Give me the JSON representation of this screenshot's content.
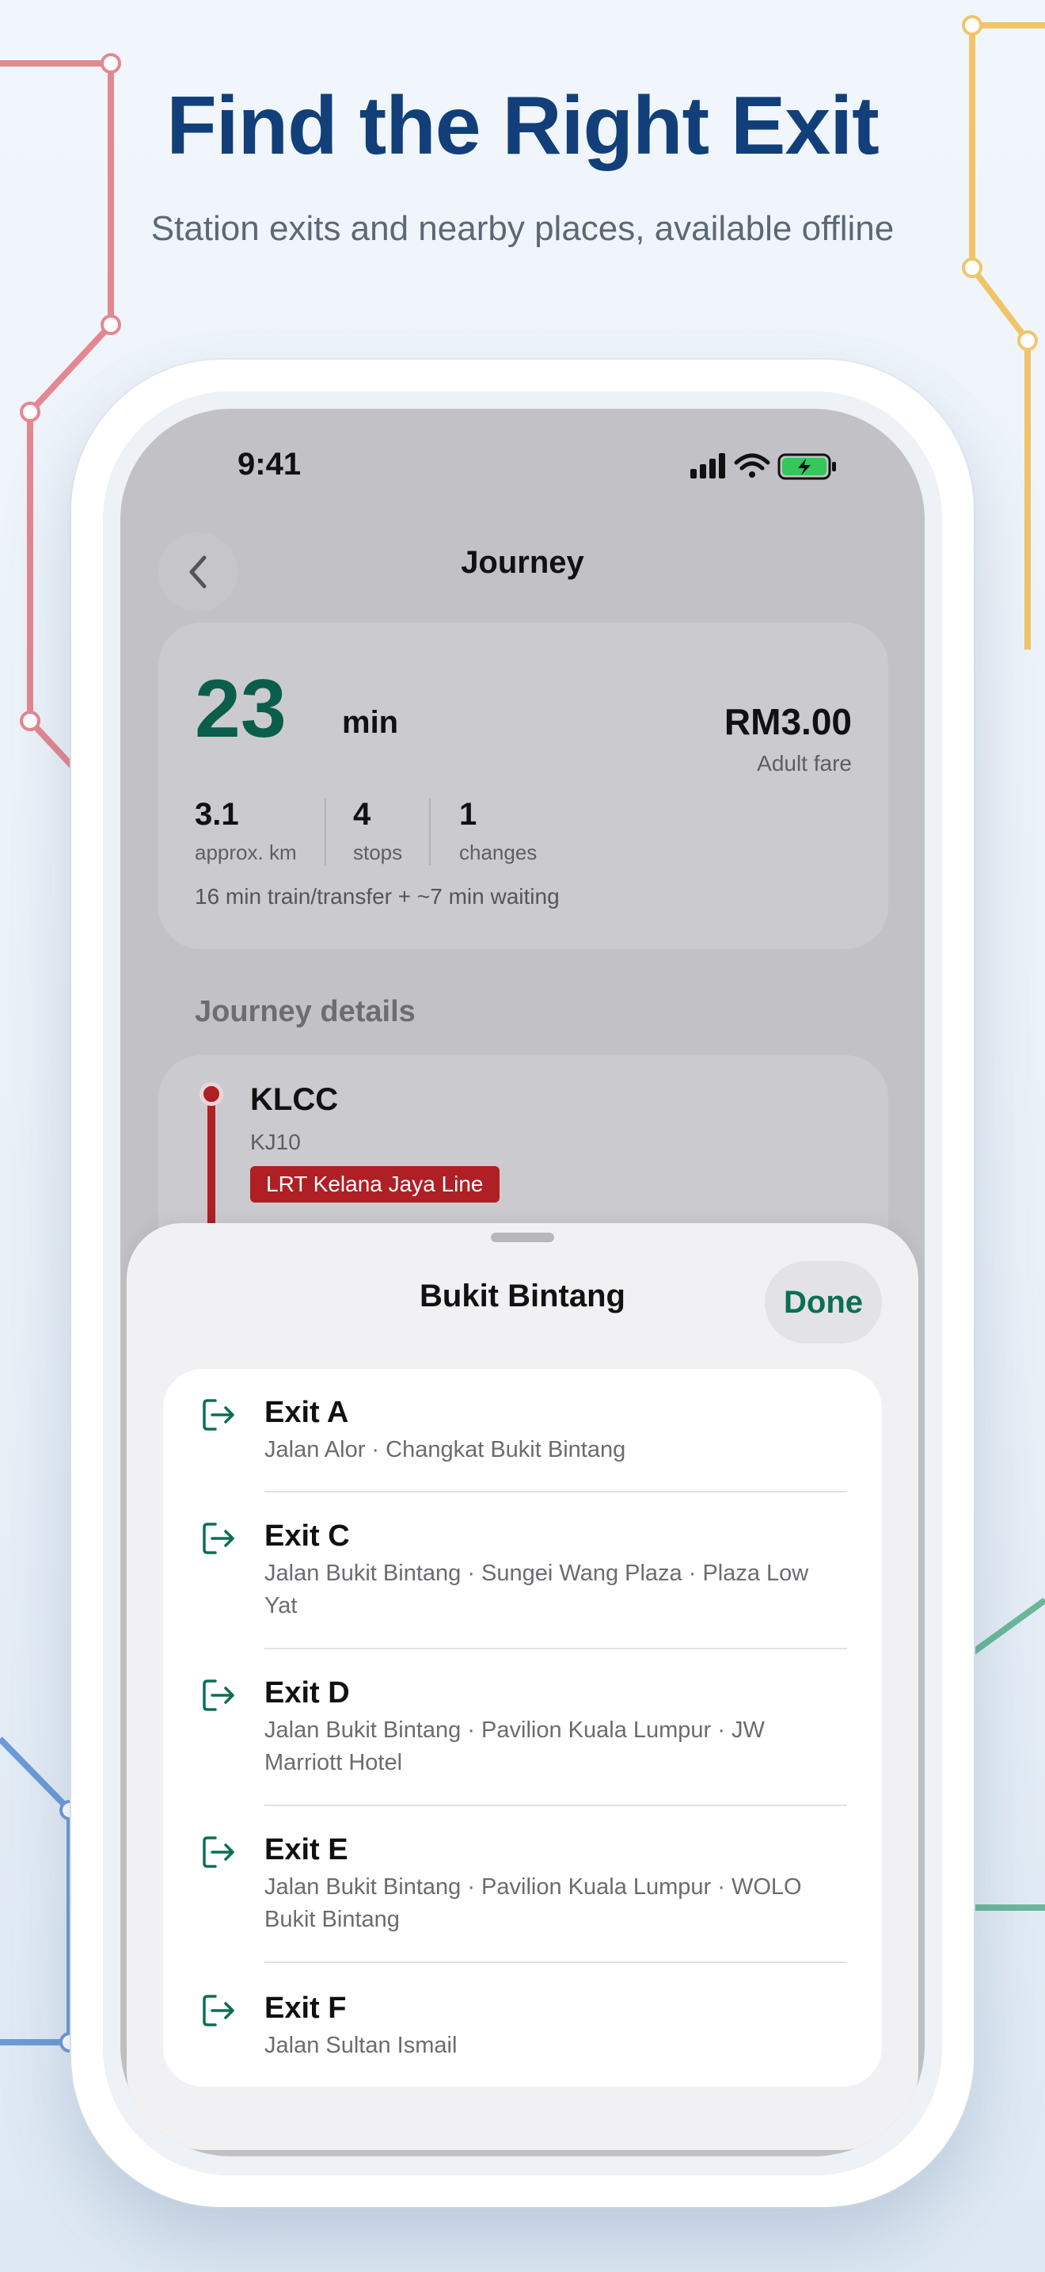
{
  "promo": {
    "headline": "Find the Right Exit",
    "subline": "Station exits and nearby places, available offline"
  },
  "colors": {
    "headline": "#123f7a",
    "accent_green": "#0b5e4b",
    "line_red": "#b01f24",
    "map_red": "#e48791",
    "map_yellow": "#f0c56a",
    "map_blue": "#6d9bd8",
    "map_green": "#6cb89a"
  },
  "status_bar": {
    "time": "9:41",
    "icons": [
      "signal-icon",
      "wifi-icon",
      "battery-charging-icon"
    ]
  },
  "nav": {
    "back_icon": "chevron-left-icon",
    "title": "Journey"
  },
  "summary": {
    "duration_value": "23",
    "duration_unit": "min",
    "fare": "RM3.00",
    "fare_label": "Adult fare",
    "stats": [
      {
        "value": "3.1",
        "label": "approx. km"
      },
      {
        "value": "4",
        "label": "stops"
      },
      {
        "value": "1",
        "label": "changes"
      }
    ],
    "note": "16 min train/transfer + ~7 min waiting"
  },
  "details": {
    "section_title": "Journey details",
    "station_name": "KLCC",
    "station_code": "KJ10",
    "line_badge": "LRT Kelana Jaya Line"
  },
  "sheet": {
    "title": "Bukit Bintang",
    "done_label": "Done",
    "exits": [
      {
        "name": "Exit A",
        "desc": "Jalan Alor · Changkat Bukit Bintang"
      },
      {
        "name": "Exit C",
        "desc": "Jalan Bukit Bintang · Sungei Wang Plaza · Plaza Low Yat"
      },
      {
        "name": "Exit D",
        "desc": "Jalan Bukit Bintang · Pavilion Kuala Lumpur · JW Marriott Hotel"
      },
      {
        "name": "Exit E",
        "desc": "Jalan Bukit Bintang · Pavilion Kuala Lumpur · WOLO Bukit Bintang"
      },
      {
        "name": "Exit F",
        "desc": "Jalan Sultan Ismail"
      }
    ]
  }
}
